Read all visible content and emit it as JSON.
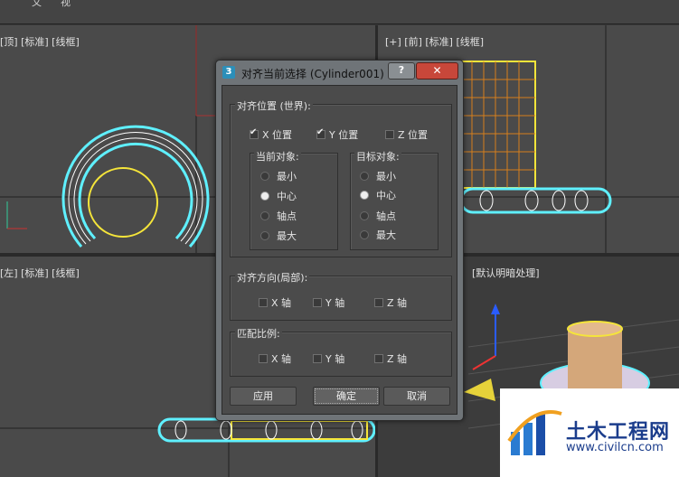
{
  "menu": {
    "item_1": "文",
    "item_2": "视"
  },
  "viewports": {
    "top_left_label": "[顶] [标准] [线框]",
    "top_left_prefix": "[+]",
    "top_right_label": "[+] [前] [标准] [线框]",
    "bottom_left_label": "[左] [标准] [线框]",
    "bottom_right_label": "[默认明暗处理]"
  },
  "dialog": {
    "title": "对齐当前选择 (Cylinder001)",
    "help_label": "?",
    "close_label": "✕",
    "position_group": {
      "title": "对齐位置 (世界):",
      "x_label": "X 位置",
      "y_label": "Y 位置",
      "z_label": "Z 位置",
      "x_checked": true,
      "y_checked": true,
      "z_checked": false
    },
    "current_object": {
      "title": "当前对象:",
      "options": [
        "最小",
        "中心",
        "轴点",
        "最大"
      ],
      "selected": "中心"
    },
    "target_object": {
      "title": "目标对象:",
      "options": [
        "最小",
        "中心",
        "轴点",
        "最大"
      ],
      "selected": "中心"
    },
    "orientation_group": {
      "title": "对齐方向(局部):",
      "x_label": "X 轴",
      "y_label": "Y 轴",
      "z_label": "Z 轴"
    },
    "scale_group": {
      "title": "匹配比例:",
      "x_label": "X 轴",
      "y_label": "Y 轴",
      "z_label": "Z 轴"
    },
    "buttons": {
      "apply": "应用",
      "ok": "确定",
      "cancel": "取消"
    }
  },
  "watermark": {
    "text": "土木工程网",
    "url": "www.civilcn.com"
  },
  "colors": {
    "cyan": "#5ff0ff",
    "yellow": "#f5e53a",
    "bg": "#4a4a4a",
    "dialog_frame": "#6f7478"
  }
}
